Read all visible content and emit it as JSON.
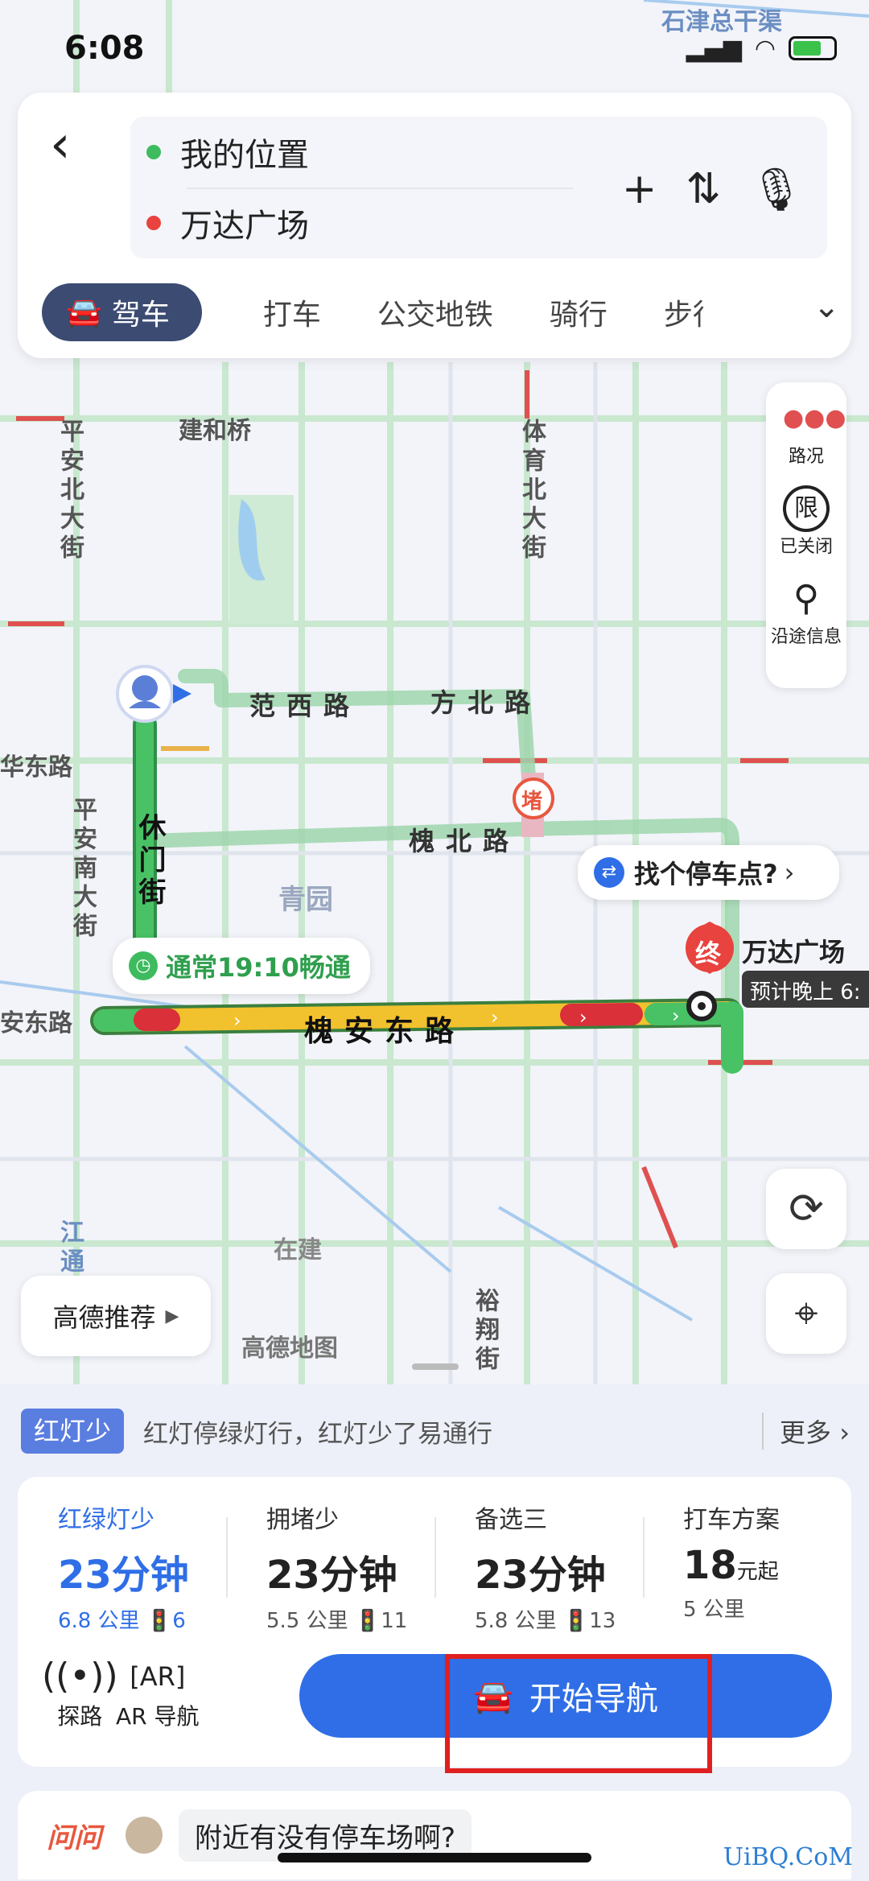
{
  "status": {
    "time": "6:08"
  },
  "search": {
    "from": "我的位置",
    "to": "万达广场"
  },
  "tabs": [
    "驾车",
    "打车",
    "公交地铁",
    "骑行",
    "步行"
  ],
  "side_tools": [
    {
      "label": "路况",
      "icon": "traffic-icon"
    },
    {
      "label": "已关闭",
      "icon": "limit-icon"
    },
    {
      "label": "沿途信息",
      "icon": "search-icon"
    }
  ],
  "map": {
    "labels": {
      "jianhe": "建和桥",
      "pinganbei": "平安北大街",
      "tiyubei": "体育北大街",
      "fanxi": "范西路",
      "fangbei": "方北路",
      "huadong": "华东路",
      "pingannan": "平安南大街",
      "xiumen": "休门街",
      "huaibei": "槐北路",
      "qingyuan": "青园",
      "andong": "安东路",
      "huaiandong": "槐安东路",
      "zaijian": "在建",
      "gaodemap": "高德地图",
      "yuxiang": "裕翔街",
      "shijin": "石津总干渠",
      "jiang": "江通"
    },
    "jam_marker": "堵",
    "end_marker": "终",
    "destination": "万达广场",
    "eta_partial": "预计晚上 6:",
    "find_parking": "找个停车点?",
    "usual": "通常19:10畅通",
    "gaode_recommend": "高德推荐"
  },
  "hint": {
    "tag": "红灯少",
    "text": "红灯停绿灯行，红灯少了易通行",
    "more": "更多"
  },
  "routes": [
    {
      "name": "红绿灯少",
      "duration": "23分钟",
      "meta": "6.8 公里  🚦6"
    },
    {
      "name": "拥堵少",
      "duration": "23分钟",
      "meta": "5.5 公里  🚦11"
    },
    {
      "name": "备选三",
      "duration": "23分钟",
      "meta": "5.8 公里  🚦13"
    },
    {
      "name": "打车方案",
      "duration": "18",
      "unit": "元起",
      "meta": "5 公里"
    }
  ],
  "actions": {
    "explore": "探路",
    "ar": "AR 导航",
    "start": "开始导航"
  },
  "ask": {
    "brand": "问问",
    "question": "附近有没有停车场啊?"
  },
  "watermark": "UiBQ.CoM",
  "colors": {
    "primary": "#2f6ee6",
    "tab_active": "#3b4b72",
    "route_green": "#3dbb5e",
    "route_yellow": "#f2c12e",
    "route_red": "#d9303a"
  }
}
